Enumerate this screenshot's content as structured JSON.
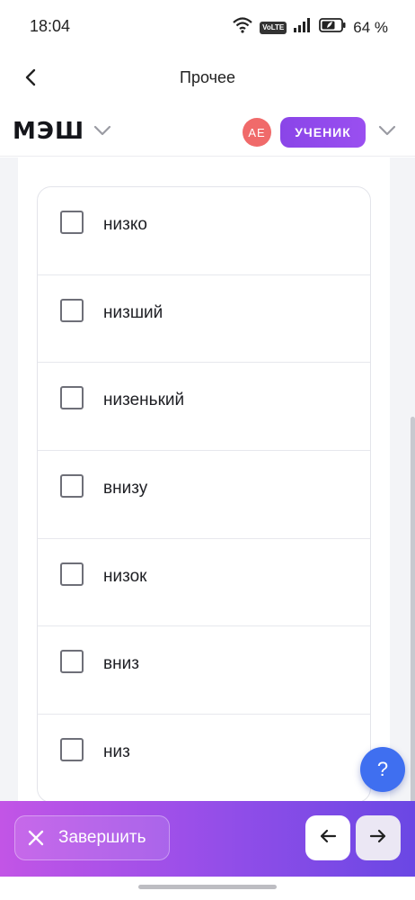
{
  "status_bar": {
    "time": "18:04",
    "network_badge": "VoLTE",
    "battery_percent": "64 %",
    "icons": [
      "wifi-icon",
      "volte-icon",
      "signal-icon",
      "battery-icon"
    ]
  },
  "top_nav": {
    "back_icon": "chevron-left-icon",
    "title": "Прочее"
  },
  "brand_bar": {
    "logo": "МЭШ",
    "avatar_initials": "АЕ",
    "role": "УЧЕНИК"
  },
  "options": [
    {
      "label": "низко",
      "checked": false
    },
    {
      "label": "низший",
      "checked": false
    },
    {
      "label": "низенький",
      "checked": false
    },
    {
      "label": "внизу",
      "checked": false
    },
    {
      "label": "низок",
      "checked": false
    },
    {
      "label": "вниз",
      "checked": false
    },
    {
      "label": "низ",
      "checked": false
    }
  ],
  "help_button": {
    "label": "?"
  },
  "bottom_bar": {
    "finish_label": "Завершить",
    "prev_icon": "arrow-left-icon",
    "next_icon": "arrow-right-icon"
  },
  "colors": {
    "accent_purple": "#9a4ff0",
    "avatar_red": "#f06a6a",
    "help_blue": "#3f6ff0",
    "bottom_gradient_start": "#c255e6",
    "bottom_gradient_end": "#6a47e4"
  }
}
